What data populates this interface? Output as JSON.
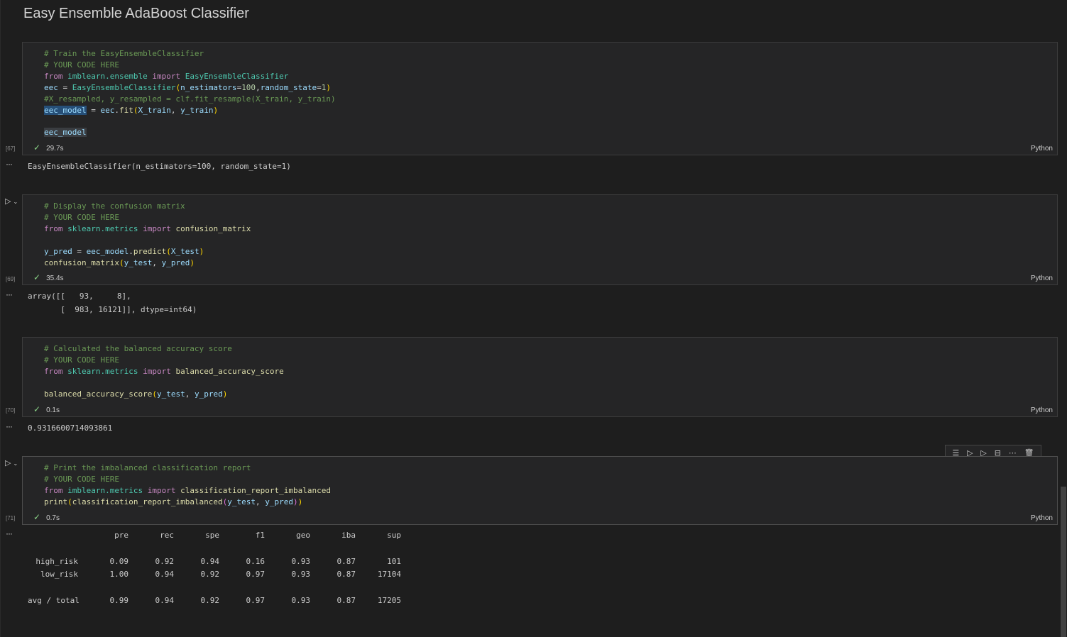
{
  "heading": "Easy Ensemble AdaBoost Classifier",
  "language": "Python",
  "cells": [
    {
      "exec": "[67]",
      "time": "29.7s",
      "lines": {
        "c1": "# Train the EasyEnsembleClassifier",
        "c2": "# YOUR CODE HERE",
        "c3_from": "from",
        "c3_mod": "imblearn.ensemble",
        "c3_import": "import",
        "c3_name": "EasyEnsembleClassifier",
        "c4_var": "eec",
        "c4_eq": " = ",
        "c4_cls": "EasyEnsembleClassifier",
        "c4_args_a": "n_estimators",
        "c4_num_a": "100",
        "c4_args_b": "random_state",
        "c4_num_b": "1",
        "c5": "#X_resampled, y_resampled = clf.fit_resample(X_train, y_train)",
        "c6_var": "eec_model",
        "c6_eq": " = ",
        "c6_obj": "eec",
        "c6_fn": "fit",
        "c6_a": "X_train",
        "c6_b": "y_train",
        "c7": "eec_model"
      },
      "output": "EasyEnsembleClassifier(n_estimators=100, random_state=1)"
    },
    {
      "exec": "[69]",
      "time": "35.4s",
      "lines": {
        "c1": "# Display the confusion matrix",
        "c2": "# YOUR CODE HERE",
        "c3_from": "from",
        "c3_mod": "sklearn.metrics",
        "c3_import": "import",
        "c3_name": "confusion_matrix",
        "c4_var": "y_pred",
        "c4_obj": "eec_model",
        "c4_fn": "predict",
        "c4_a": "X_test",
        "c5_fn": "confusion_matrix",
        "c5_a": "y_test",
        "c5_b": "y_pred"
      },
      "output_line1": "array([[   93,     8],",
      "output_line2": "       [  983, 16121]], dtype=int64)"
    },
    {
      "exec": "[70]",
      "time": "0.1s",
      "lines": {
        "c1": "# Calculated the balanced accuracy score",
        "c2": "# YOUR CODE HERE",
        "c3_from": "from",
        "c3_mod": "sklearn.metrics",
        "c3_import": "import",
        "c3_name": "balanced_accuracy_score",
        "c4_fn": "balanced_accuracy_score",
        "c4_a": "y_test",
        "c4_b": "y_pred"
      },
      "output": "0.9316600714093861"
    },
    {
      "exec": "[71]",
      "time": "0.7s",
      "lines": {
        "c1": "# Print the imbalanced classification report",
        "c2": "# YOUR CODE HERE",
        "c3_from": "from",
        "c3_mod": "imblearn.metrics",
        "c3_import": "import",
        "c3_name": "classification_report_imbalanced",
        "c4_print": "print",
        "c4_fn": "classification_report_imbalanced",
        "c4_a": "y_test",
        "c4_b": "y_pred"
      }
    }
  ],
  "report": {
    "headers": [
      "pre",
      "rec",
      "spe",
      "f1",
      "geo",
      "iba",
      "sup"
    ],
    "rows": [
      {
        "label": "high_risk",
        "values": [
          "0.09",
          "0.92",
          "0.94",
          "0.16",
          "0.93",
          "0.87",
          "101"
        ]
      },
      {
        "label": "low_risk",
        "values": [
          "1.00",
          "0.94",
          "0.92",
          "0.97",
          "0.93",
          "0.87",
          "17104"
        ]
      },
      {
        "label": "avg / total",
        "values": [
          "0.99",
          "0.94",
          "0.92",
          "0.97",
          "0.93",
          "0.87",
          "17205"
        ]
      }
    ]
  },
  "toolbar": {
    "icons": [
      "run-by-line-icon",
      "execute-above-icon",
      "execute-below-icon",
      "split-cell-icon",
      "more-icon",
      "delete-icon"
    ]
  }
}
